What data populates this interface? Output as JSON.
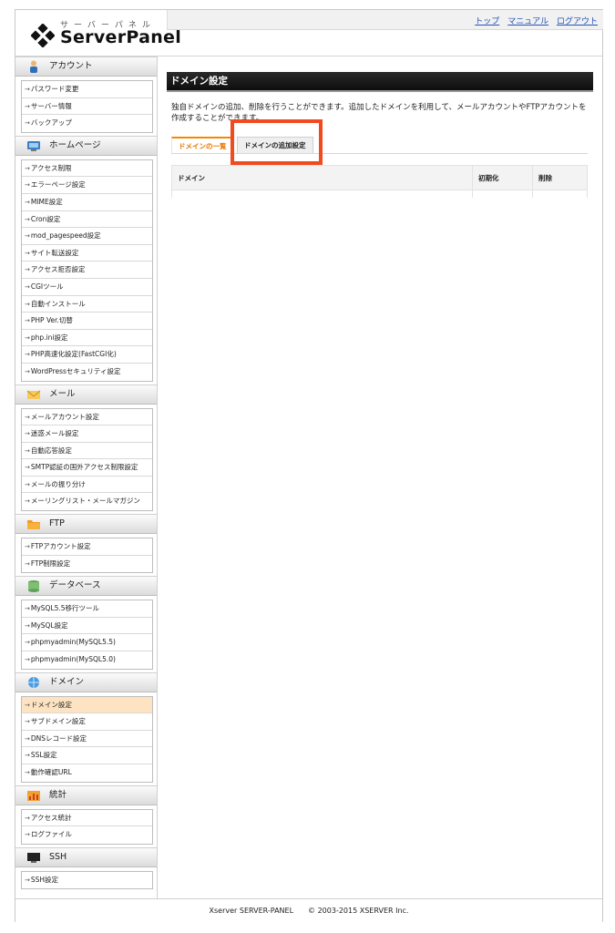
{
  "header": {
    "logo_kana": "サーバーパネル",
    "logo_name": "ServerPanel",
    "links": [
      "トップ",
      "マニュアル",
      "ログアウト"
    ]
  },
  "sidebar": {
    "sections": [
      {
        "title": "アカウント",
        "icon": "person-icon",
        "items": [
          "パスワード変更",
          "サーバー情報",
          "バックアップ"
        ]
      },
      {
        "title": "ホームページ",
        "icon": "monitor-icon",
        "items": [
          "アクセス制限",
          "エラーページ設定",
          "MIME設定",
          "Cron設定",
          "mod_pagespeed設定",
          "サイト転送設定",
          "アクセス拒否設定",
          "CGIツール",
          "自動インストール",
          "PHP Ver.切替",
          "php.ini設定",
          "PHP高速化設定(FastCGI化)",
          "WordPressセキュリティ設定"
        ]
      },
      {
        "title": "メール",
        "icon": "envelope-icon",
        "items": [
          "メールアカウント設定",
          "迷惑メール設定",
          "自動応答設定",
          "SMTP認証の国外アクセス制限設定",
          "メールの振り分け",
          "メーリングリスト・メールマガジン"
        ]
      },
      {
        "title": "FTP",
        "icon": "folder-icon",
        "items": [
          "FTPアカウント設定",
          "FTP制限設定"
        ]
      },
      {
        "title": "データベース",
        "icon": "database-icon",
        "items": [
          "MySQL5.5移行ツール",
          "MySQL設定",
          "phpmyadmin(MySQL5.5)",
          "phpmyadmin(MySQL5.0)"
        ]
      },
      {
        "title": "ドメイン",
        "icon": "globe-icon",
        "items": [
          "ドメイン設定",
          "サブドメイン設定",
          "DNSレコード設定",
          "SSL設定",
          "動作確認URL"
        ],
        "active": 0
      },
      {
        "title": "統計",
        "icon": "stats-icon",
        "items": [
          "アクセス統計",
          "ログファイル"
        ]
      },
      {
        "title": "SSH",
        "icon": "terminal-icon",
        "items": [
          "SSH設定"
        ]
      }
    ]
  },
  "main": {
    "title": "ドメイン設定",
    "description": "独自ドメインの追加、削除を行うことができます。追加したドメインを利用して、メールアカウントやFTPアカウントを作成することができます。",
    "tabs": [
      "ドメインの一覧",
      "ドメインの追加設定"
    ],
    "table_headers": [
      "ドメイン",
      "初期化",
      "削除"
    ]
  },
  "footer": {
    "text": "Xserver SERVER-PANEL　　© 2003-2015 XSERVER Inc."
  },
  "colors": {
    "accent_orange": "#f28a00",
    "highlight_red": "#f24a1f",
    "link_blue": "#2255bb"
  }
}
